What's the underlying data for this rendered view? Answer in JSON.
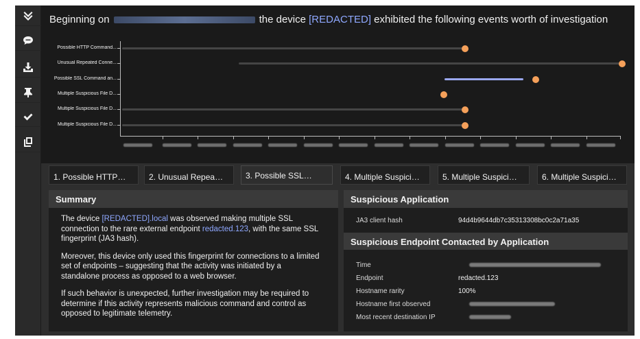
{
  "sidebar": {
    "buttons": [
      {
        "name": "collapse-icon"
      },
      {
        "name": "comment-icon"
      },
      {
        "name": "download-icon"
      },
      {
        "name": "pin-icon"
      },
      {
        "name": "check-icon"
      },
      {
        "name": "copy-icon"
      }
    ]
  },
  "header": {
    "title_prefix": "Beginning on",
    "title_middle": "the device",
    "title_device": "[REDACTED]",
    "title_suffix": "exhibited the following events worth of investigation"
  },
  "timeline": {
    "rows": [
      {
        "label": "Possible HTTP Command..."
      },
      {
        "label": "Unusual Repeated Conne..."
      },
      {
        "label": "Possible SSL Command an..."
      },
      {
        "label": "Multiple Suspicious File D..."
      },
      {
        "label": "Multiple Suspicious File D..."
      },
      {
        "label": "Multiple Suspicious File D..."
      }
    ],
    "colors": {
      "dot": "#f5a05a",
      "active_line": "#9aa7ee",
      "line": "#454545"
    }
  },
  "tabs": [
    {
      "label": "1. Possible HTTP…"
    },
    {
      "label": "2. Unusual Repea…"
    },
    {
      "label": "3. Possible SSL…"
    },
    {
      "label": "4. Multiple Suspici…"
    },
    {
      "label": "5. Multiple Suspici…"
    },
    {
      "label": "6. Multiple Suspici…"
    }
  ],
  "summary": {
    "heading": "Summary",
    "p1_a": "The device ",
    "p1_device": "[REDACTED].local",
    "p1_b": " was observed making multiple SSL connection to the rare external endpoint ",
    "p1_endpoint": "redacted.123",
    "p1_c": ", with the same SSL fingerprint (JA3 hash).",
    "p2": "Moreover, this device only used this fingerprint for connections to a limited set of endpoints – suggesting that the activity was initiated by a standalone process as opposed to a web browser.",
    "p3": "If such behavior is unexpected, further investigation may be required to determine if this activity represents malicious command and control as opposed to legitimate telemetry."
  },
  "suspicious_application": {
    "heading": "Suspicious Application",
    "ja3_label": "JA3 client hash",
    "ja3_value": "94d4b9644db7c35313308bc0c2a71a35"
  },
  "endpoint": {
    "heading": "Suspicious Endpoint Contacted by Application",
    "time_label": "Time",
    "endpoint_label": "Endpoint",
    "endpoint_value": "redacted.123",
    "rarity_label": "Hostname rarity",
    "rarity_value": "100%",
    "first_observed_label": "Hostname first observed",
    "recent_ip_label": "Most recent destination IP"
  }
}
